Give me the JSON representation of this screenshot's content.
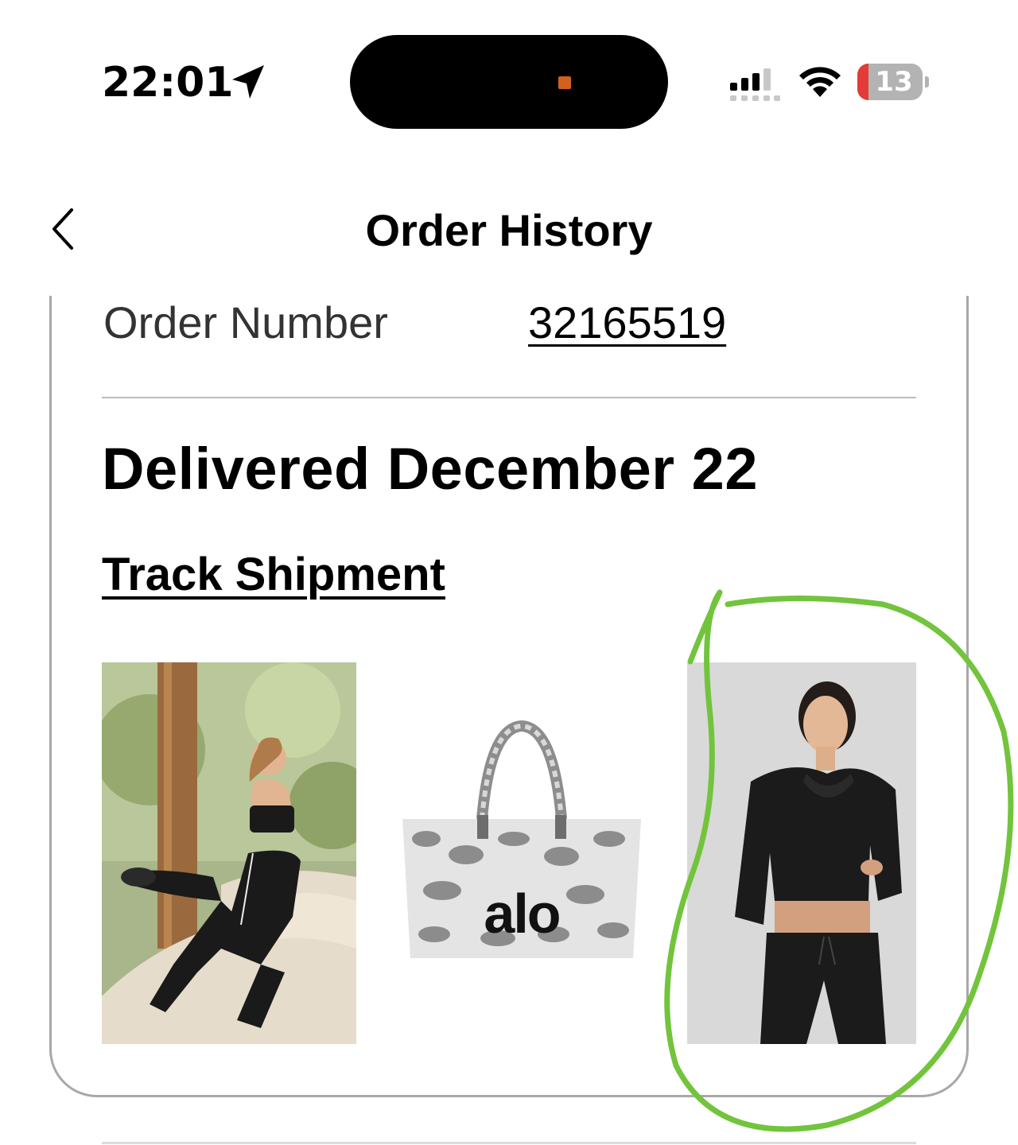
{
  "status_bar": {
    "time": "22:01",
    "battery_level": "13",
    "icons": [
      "location-arrow-icon",
      "cellular-signal-icon",
      "wifi-icon",
      "battery-icon"
    ]
  },
  "nav": {
    "title": "Order History",
    "back_icon": "chevron-left-icon"
  },
  "order": {
    "number_label": "Order Number",
    "number": "32165519",
    "status": "Delivered December 22",
    "track_label": "Track Shipment",
    "products": [
      {
        "name": "product-image-leggings-bra"
      },
      {
        "name": "product-image-tote-bag",
        "logo_text": "alo"
      },
      {
        "name": "product-image-cropped-hoodie"
      }
    ]
  },
  "colors": {
    "annotation_stroke": "#72c43c",
    "battery_low": "#e33b35",
    "island_indicator": "#d3611e"
  }
}
